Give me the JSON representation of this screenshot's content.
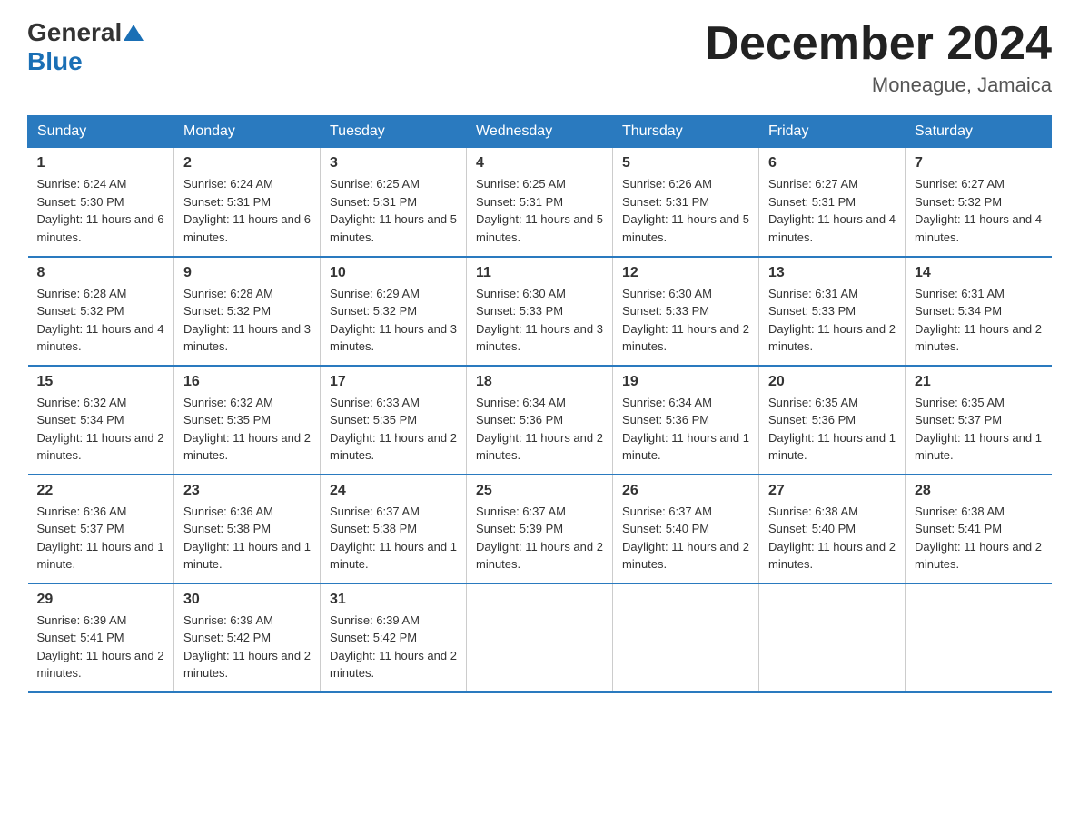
{
  "header": {
    "logo_general": "General",
    "logo_blue": "Blue",
    "month_title": "December 2024",
    "location": "Moneague, Jamaica"
  },
  "days_of_week": [
    "Sunday",
    "Monday",
    "Tuesday",
    "Wednesday",
    "Thursday",
    "Friday",
    "Saturday"
  ],
  "weeks": [
    [
      {
        "day": "1",
        "sunrise": "6:24 AM",
        "sunset": "5:30 PM",
        "daylight": "11 hours and 6 minutes."
      },
      {
        "day": "2",
        "sunrise": "6:24 AM",
        "sunset": "5:31 PM",
        "daylight": "11 hours and 6 minutes."
      },
      {
        "day": "3",
        "sunrise": "6:25 AM",
        "sunset": "5:31 PM",
        "daylight": "11 hours and 5 minutes."
      },
      {
        "day": "4",
        "sunrise": "6:25 AM",
        "sunset": "5:31 PM",
        "daylight": "11 hours and 5 minutes."
      },
      {
        "day": "5",
        "sunrise": "6:26 AM",
        "sunset": "5:31 PM",
        "daylight": "11 hours and 5 minutes."
      },
      {
        "day": "6",
        "sunrise": "6:27 AM",
        "sunset": "5:31 PM",
        "daylight": "11 hours and 4 minutes."
      },
      {
        "day": "7",
        "sunrise": "6:27 AM",
        "sunset": "5:32 PM",
        "daylight": "11 hours and 4 minutes."
      }
    ],
    [
      {
        "day": "8",
        "sunrise": "6:28 AM",
        "sunset": "5:32 PM",
        "daylight": "11 hours and 4 minutes."
      },
      {
        "day": "9",
        "sunrise": "6:28 AM",
        "sunset": "5:32 PM",
        "daylight": "11 hours and 3 minutes."
      },
      {
        "day": "10",
        "sunrise": "6:29 AM",
        "sunset": "5:32 PM",
        "daylight": "11 hours and 3 minutes."
      },
      {
        "day": "11",
        "sunrise": "6:30 AM",
        "sunset": "5:33 PM",
        "daylight": "11 hours and 3 minutes."
      },
      {
        "day": "12",
        "sunrise": "6:30 AM",
        "sunset": "5:33 PM",
        "daylight": "11 hours and 2 minutes."
      },
      {
        "day": "13",
        "sunrise": "6:31 AM",
        "sunset": "5:33 PM",
        "daylight": "11 hours and 2 minutes."
      },
      {
        "day": "14",
        "sunrise": "6:31 AM",
        "sunset": "5:34 PM",
        "daylight": "11 hours and 2 minutes."
      }
    ],
    [
      {
        "day": "15",
        "sunrise": "6:32 AM",
        "sunset": "5:34 PM",
        "daylight": "11 hours and 2 minutes."
      },
      {
        "day": "16",
        "sunrise": "6:32 AM",
        "sunset": "5:35 PM",
        "daylight": "11 hours and 2 minutes."
      },
      {
        "day": "17",
        "sunrise": "6:33 AM",
        "sunset": "5:35 PM",
        "daylight": "11 hours and 2 minutes."
      },
      {
        "day": "18",
        "sunrise": "6:34 AM",
        "sunset": "5:36 PM",
        "daylight": "11 hours and 2 minutes."
      },
      {
        "day": "19",
        "sunrise": "6:34 AM",
        "sunset": "5:36 PM",
        "daylight": "11 hours and 1 minute."
      },
      {
        "day": "20",
        "sunrise": "6:35 AM",
        "sunset": "5:36 PM",
        "daylight": "11 hours and 1 minute."
      },
      {
        "day": "21",
        "sunrise": "6:35 AM",
        "sunset": "5:37 PM",
        "daylight": "11 hours and 1 minute."
      }
    ],
    [
      {
        "day": "22",
        "sunrise": "6:36 AM",
        "sunset": "5:37 PM",
        "daylight": "11 hours and 1 minute."
      },
      {
        "day": "23",
        "sunrise": "6:36 AM",
        "sunset": "5:38 PM",
        "daylight": "11 hours and 1 minute."
      },
      {
        "day": "24",
        "sunrise": "6:37 AM",
        "sunset": "5:38 PM",
        "daylight": "11 hours and 1 minute."
      },
      {
        "day": "25",
        "sunrise": "6:37 AM",
        "sunset": "5:39 PM",
        "daylight": "11 hours and 2 minutes."
      },
      {
        "day": "26",
        "sunrise": "6:37 AM",
        "sunset": "5:40 PM",
        "daylight": "11 hours and 2 minutes."
      },
      {
        "day": "27",
        "sunrise": "6:38 AM",
        "sunset": "5:40 PM",
        "daylight": "11 hours and 2 minutes."
      },
      {
        "day": "28",
        "sunrise": "6:38 AM",
        "sunset": "5:41 PM",
        "daylight": "11 hours and 2 minutes."
      }
    ],
    [
      {
        "day": "29",
        "sunrise": "6:39 AM",
        "sunset": "5:41 PM",
        "daylight": "11 hours and 2 minutes."
      },
      {
        "day": "30",
        "sunrise": "6:39 AM",
        "sunset": "5:42 PM",
        "daylight": "11 hours and 2 minutes."
      },
      {
        "day": "31",
        "sunrise": "6:39 AM",
        "sunset": "5:42 PM",
        "daylight": "11 hours and 2 minutes."
      },
      null,
      null,
      null,
      null
    ]
  ]
}
